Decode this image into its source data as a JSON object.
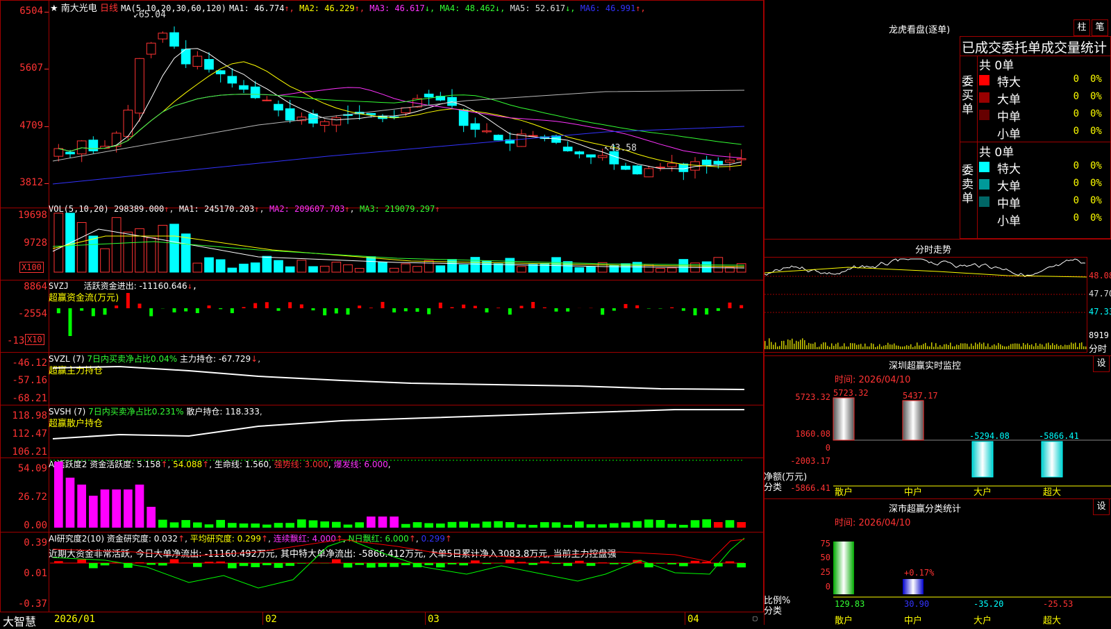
{
  "main_chart": {
    "stock_name": "南大光电",
    "period": "日线",
    "ma_params": "MA(5,10,20,30,60,120)",
    "ma_values": [
      {
        "label": "MA1:",
        "value": "46.774",
        "arrow": "↑",
        "color": "#ffffff"
      },
      {
        "label": "MA2:",
        "value": "46.229",
        "arrow": "↑",
        "color": "#ffff00"
      },
      {
        "label": "MA3:",
        "value": "46.617",
        "arrow": "↓",
        "color": "#ff33ff"
      },
      {
        "label": "MA4:",
        "value": "48.462",
        "arrow": "↓",
        "color": "#33ff33"
      },
      {
        "label": "MA5:",
        "value": "52.617",
        "arrow": "↓",
        "color": "#dddddd"
      },
      {
        "label": "MA6:",
        "value": "46.991",
        "arrow": "↑",
        "color": "#3333ff"
      }
    ],
    "y_ticks": [
      "6504",
      "5607",
      "4709",
      "3812"
    ],
    "high_label": "65.04",
    "low_label": "43.58"
  },
  "volume": {
    "params": "VOL(5,10,20)",
    "value": "298389.000",
    "ma1": "MA1: 245170.203",
    "ma2": "MA2: 209607.703",
    "ma3": "MA3: 219079.297",
    "y_ticks": [
      "19698",
      "9728"
    ],
    "unit": "X100"
  },
  "svzj": {
    "title": "SVZJ",
    "label": "活跃资金进出: -11160.646",
    "subtitle": "超赢资金流(万元)",
    "y_ticks": [
      "8864",
      "-2554",
      "-13"
    ],
    "unit": "X10"
  },
  "svzl": {
    "title": "SVZL (7)",
    "ratio": "7日内买卖净占比0.04%",
    "hold": "主力持仓: -67.729",
    "subtitle": "超赢主力持仓",
    "y_ticks": [
      "-46.12",
      "-57.16",
      "-68.21"
    ]
  },
  "svsh": {
    "title": "SVSH (7)",
    "ratio": "7日内买卖净占比0.231%",
    "hold": "散户持仓: 118.333",
    "subtitle": "超赢散户持仓",
    "y_ticks": [
      "118.98",
      "112.47",
      "106.21"
    ]
  },
  "ai_active": {
    "title": "AI活跃度2",
    "v1": "资金活跃度: 5.158",
    "v2": "54.088",
    "v3": "生命线: 1.560",
    "v4": "强势线: 3.000",
    "v5": "爆发线: 6.000",
    "y_ticks": [
      "54.09",
      "26.72",
      "0.00"
    ]
  },
  "ai_research": {
    "title": "AI研究度2(10)",
    "v1": "资金研究度: 0.032",
    "v2": "平均研究度: 0.299",
    "v3": "连续飘红: 4.000",
    "v4": "N日飘红: 6.000",
    "v5": "0.299",
    "comment": "近期大资金非常活跃, 今日大单净流出: -11160.492万元, 其中特大单净流出: -5866.412万元, 大单5日累计净入3083.8万元, 当前主力控盘强",
    "y_ticks": [
      "0.39",
      "0.01",
      "-0.37"
    ]
  },
  "x_axis": {
    "labels": [
      "2026/01",
      "02",
      "03",
      "04"
    ]
  },
  "logo": "大智慧",
  "right_panel": {
    "dragon_tiger": "龙虎看盘(逐单)",
    "btn_column": "柱",
    "btn_stroke": "笔",
    "stats_title": "已成交委托单成交量统计",
    "buy_label": "委买单",
    "sell_label": "委卖单",
    "total": "共 0单",
    "rows_buy": [
      {
        "name": "特大",
        "count": "0",
        "pct": "0%",
        "color": "#ff0000"
      },
      {
        "name": "大单",
        "count": "0",
        "pct": "0%",
        "color": "#990000"
      },
      {
        "name": "中单",
        "count": "0",
        "pct": "0%",
        "color": "#660000"
      },
      {
        "name": "小单",
        "count": "0",
        "pct": "0%",
        "color": "#000000"
      }
    ],
    "rows_sell": [
      {
        "name": "特大",
        "count": "0",
        "pct": "0%",
        "color": "#00ffff"
      },
      {
        "name": "大单",
        "count": "0",
        "pct": "0%",
        "color": "#009999"
      },
      {
        "name": "中单",
        "count": "0",
        "pct": "0%",
        "color": "#006666"
      },
      {
        "name": "小单",
        "count": "0",
        "pct": "0%",
        "color": "#000000"
      }
    ],
    "intraday_title": "分时走势",
    "intraday_ticks": [
      "48.08",
      "47.70",
      "47.33"
    ],
    "intraday_vol": "8919",
    "intraday_unit": "分时",
    "monitor_title": "深圳超赢实时监控",
    "monitor_btn": "设",
    "monitor_time": "时间: 2026/04/10",
    "monitor_y": [
      "5723.32",
      "1860.08",
      "0",
      "-2003.17",
      "-5866.41"
    ],
    "monitor_bars": [
      {
        "name": "散户",
        "value": "5723.32"
      },
      {
        "name": "中户",
        "value": "5437.17"
      },
      {
        "name": "大户",
        "value": "-5294.08"
      },
      {
        "name": "超大",
        "value": "-5866.41"
      }
    ],
    "monitor_axis1": "净额(万元)",
    "monitor_axis2": "分类",
    "class_title": "深市超赢分类统计",
    "class_btn": "设",
    "class_time": "时间: 2026/04/10",
    "class_y": [
      "75",
      "50",
      "25",
      "0"
    ],
    "class_ratio": "+0.17%",
    "class_bars": [
      {
        "name": "散户",
        "value": "129.83"
      },
      {
        "name": "中户",
        "value": "30.90"
      },
      {
        "name": "大户",
        "value": "-35.20"
      },
      {
        "name": "超大",
        "value": "-25.53"
      }
    ],
    "class_axis1": "比例%",
    "class_axis2": "分类"
  },
  "colors": {
    "up": "#ff3333",
    "down": "#00ffff",
    "grid": "#a00000",
    "ma1": "#ffffff",
    "ma2": "#ffff00",
    "ma3": "#ff33ff",
    "ma4": "#33ff33",
    "ma5": "#bbbbbb",
    "ma6": "#3333ff"
  }
}
